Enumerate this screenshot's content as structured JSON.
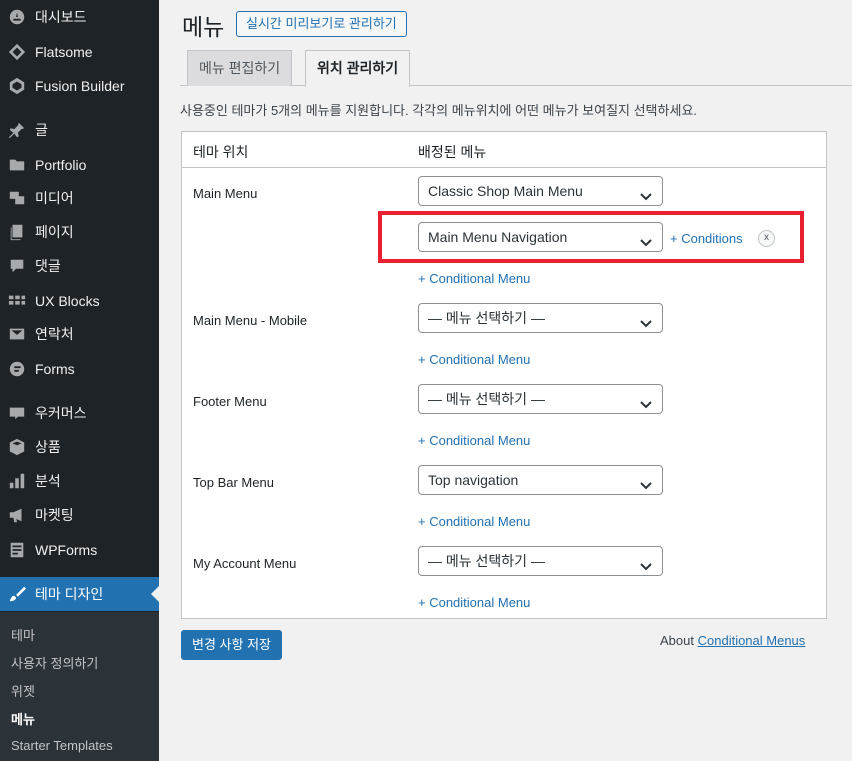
{
  "sidebar": {
    "items": [
      {
        "label": "대시보드",
        "icon": "dashboard-icon"
      },
      {
        "label": "Flatsome",
        "icon": "flatsome-icon"
      },
      {
        "label": "Fusion Builder",
        "icon": "fusion-builder-icon"
      },
      {
        "label": "글",
        "icon": "pin-icon"
      },
      {
        "label": "Portfolio",
        "icon": "folder-icon"
      },
      {
        "label": "미디어",
        "icon": "media-icon"
      },
      {
        "label": "페이지",
        "icon": "page-icon"
      },
      {
        "label": "댓글",
        "icon": "comment-icon"
      },
      {
        "label": "UX Blocks",
        "icon": "blocks-icon"
      },
      {
        "label": "연락처",
        "icon": "mail-icon"
      },
      {
        "label": "Forms",
        "icon": "forms-icon"
      },
      {
        "label": "우커머스",
        "icon": "woo-icon"
      },
      {
        "label": "상품",
        "icon": "product-box-icon"
      },
      {
        "label": "분석",
        "icon": "bar-chart-icon"
      },
      {
        "label": "마켓팅",
        "icon": "megaphone-icon"
      },
      {
        "label": "WPForms",
        "icon": "wpforms-icon"
      },
      {
        "label": "테마 디자인",
        "icon": "paintbrush-icon"
      }
    ],
    "submenu": [
      "테마",
      "사용자 정의하기",
      "위젯",
      "메뉴",
      "Starter Templates"
    ]
  },
  "header": {
    "title": "메뉴",
    "live_preview_label": "실시간 미리보기로 관리하기"
  },
  "tabs": {
    "edit_label": "메뉴 편집하기",
    "locations_label": "위치 관리하기"
  },
  "description": "사용중인 테마가 5개의 메뉴를 지원합니다. 각각의 메뉴위치에 어떤 메뉴가 보여질지 선택하세요.",
  "table": {
    "col_location": "테마 위치",
    "col_assigned": "배정된 메뉴"
  },
  "locations": [
    {
      "name": "Main Menu",
      "selected": "Classic Shop Main Menu"
    },
    {
      "name": "Main Menu - Mobile",
      "selected": "— 메뉴 선택하기 —"
    },
    {
      "name": "Footer Menu",
      "selected": "— 메뉴 선택하기 —"
    },
    {
      "name": "Top Bar Menu",
      "selected": "Top navigation"
    },
    {
      "name": "My Account Menu",
      "selected": "— 메뉴 선택하기 —"
    }
  ],
  "conditional": {
    "selected": "Main Menu Navigation",
    "conditions_label": "+ Conditions",
    "remove_label": "x",
    "add_label": "+ Conditional Menu"
  },
  "footer": {
    "save_label": "변경 사항 저장",
    "about_prefix": "About",
    "about_link": "Conditional Menus"
  },
  "colors": {
    "accent": "#2271b1",
    "sidebar_bg": "#1d2327",
    "highlight": "#e8202f"
  }
}
